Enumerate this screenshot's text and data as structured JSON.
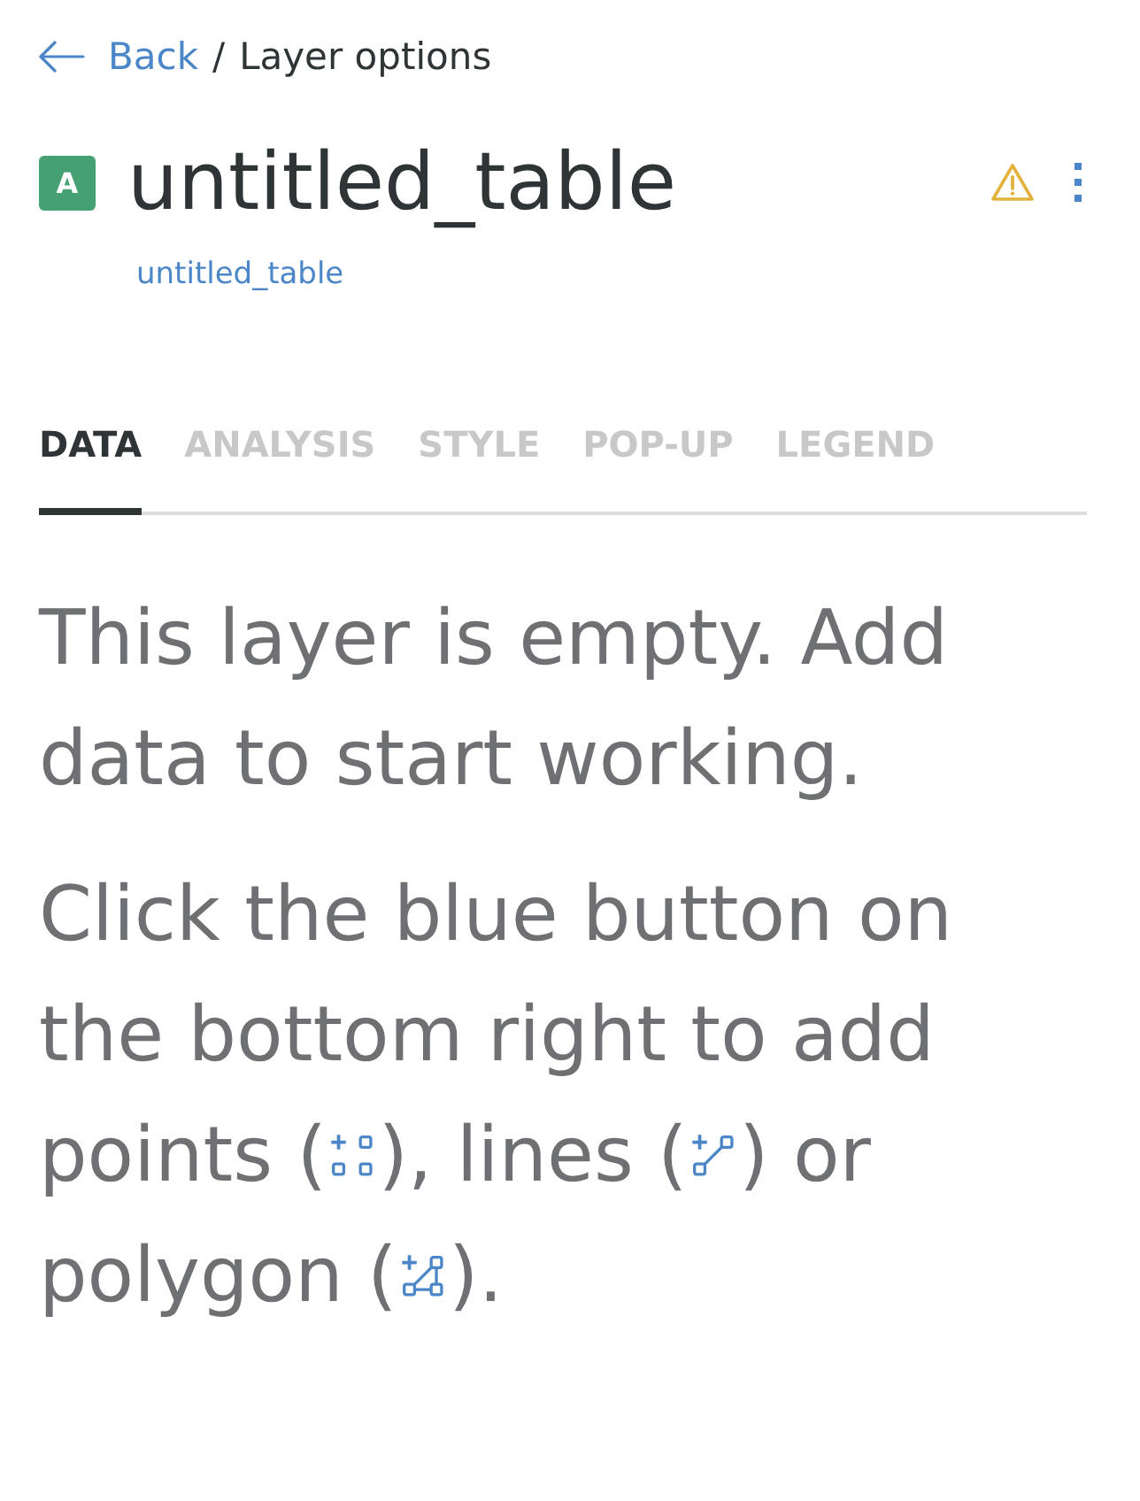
{
  "breadcrumb": {
    "back": "Back",
    "separator": "/",
    "current": "Layer options"
  },
  "layer": {
    "badge": "A",
    "title": "untitled_table",
    "source": "untitled_table",
    "warning": true
  },
  "tabs": [
    {
      "label": "DATA",
      "selected": true
    },
    {
      "label": "ANALYSIS",
      "selected": false
    },
    {
      "label": "STYLE",
      "selected": false
    },
    {
      "label": "POP-UP",
      "selected": false
    },
    {
      "label": "LEGEND",
      "selected": false
    }
  ],
  "empty_state": {
    "heading": "This layer is empty. Add data to start working.",
    "instructions": [
      "Click the blue button on the bottom right to add points (",
      "), lines (",
      ") or polygon (",
      ")."
    ]
  }
}
